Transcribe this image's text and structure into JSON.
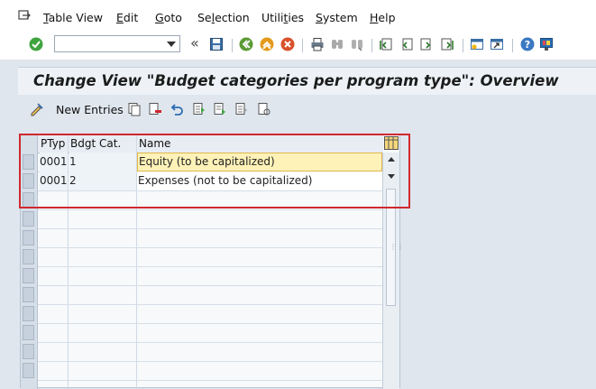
{
  "menubar": {
    "items": [
      {
        "label": "Table View",
        "u": "T"
      },
      {
        "label": "Edit",
        "u": "E"
      },
      {
        "label": "Goto",
        "u": "G"
      },
      {
        "label": "Selection",
        "u": "l"
      },
      {
        "label": "Utilities",
        "u": "t"
      },
      {
        "label": "System",
        "u": "S"
      },
      {
        "label": "Help",
        "u": "H"
      }
    ]
  },
  "toolbar": {
    "command_field_value": "",
    "back_arrows": "«"
  },
  "title": "Change View \"Budget categories per program type\": Overview",
  "app_toolbar": {
    "new_entries_label": "New Entries"
  },
  "table": {
    "headers": [
      "PTyp",
      "Bdgt Cat.",
      "Name"
    ],
    "rows": [
      {
        "ptyp": "0001",
        "cat": "1",
        "name": "Equity (to be capitalized)",
        "selected": true
      },
      {
        "ptyp": "0001",
        "cat": "2",
        "name": "Expenses (not to be capitalized)",
        "selected": false
      }
    ],
    "empty_rows": 10
  },
  "colors": {
    "highlight_row": "#fff2b8",
    "red_box": "#d0282e",
    "title_bg": "#eef2f7"
  }
}
